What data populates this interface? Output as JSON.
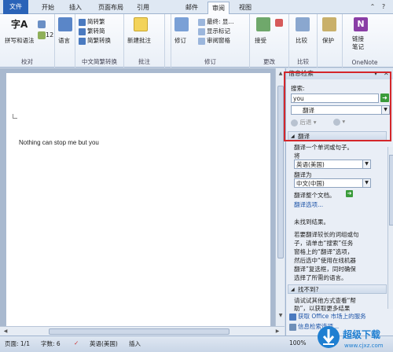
{
  "tabs": [
    "文件",
    "开始",
    "插入",
    "页面布局",
    "引用",
    "邮件",
    "审阅",
    "视图"
  ],
  "active_tab": "审阅",
  "ribbon": {
    "proofing": {
      "label": "校对",
      "spell": "拼写和语法",
      "lang": "语言"
    },
    "chinese": {
      "label": "中文简繁转换",
      "to_trad": "简转繁",
      "to_simp": "繁转简",
      "convert": "简繁转换"
    },
    "comments": {
      "label": "批注",
      "new": "新建批注"
    },
    "tracking": {
      "label": "修订",
      "track": "修订",
      "display": "最终: 显...",
      "show_markup": "显示标记",
      "review_pane": "审阅窗格"
    },
    "changes": {
      "label": "更改",
      "accept": "接受"
    },
    "compare": {
      "label": "比较",
      "compare": "比较"
    },
    "protect": {
      "label": "",
      "protect": "保护"
    },
    "onenote": {
      "label": "OneNote",
      "linked": "链接",
      "notes": "笔记"
    }
  },
  "document": {
    "text": "Nothing can stop me but you"
  },
  "pane": {
    "title": "信息检索",
    "search_label": "搜索:",
    "search_value": "you",
    "service": "翻译",
    "back": "后退",
    "section_translate": "翻译",
    "translate_desc": "翻译一个单词或句子。",
    "from_label": "将",
    "from_value": "英语(美国)",
    "to_label": "翻译为",
    "to_value": "中文(中国)",
    "translate_doc": "翻译整个文档。",
    "options": "翻译选项...",
    "no_results": "未找到结果。",
    "hint_lines": [
      "若要翻译较长的词组或句",
      "子，请单击“搜索”任务",
      "窗格上的“翻译”选项，",
      "然后选中“使用在线机器",
      "翻译”复选框，同时确保",
      "选择了所需的语言。"
    ],
    "section_notfound": "找不到?",
    "try_lines": [
      "请试试其他方式查看“帮",
      "助”，以获取更多结果"
    ],
    "footer1": "获取 Office 市场上的服务",
    "footer2": "信息检索选项..."
  },
  "status": {
    "page": "页面: 1/1",
    "words": "字数: 6",
    "lang": "英语(美国)",
    "insert": "插入",
    "zoom": "100%"
  },
  "watermark": {
    "text": "超级下载",
    "url": "www.cjxz.com"
  },
  "colors": {
    "accent": "#2a63b8",
    "highlight": "#d4262a",
    "go": "#3a9b3a"
  }
}
